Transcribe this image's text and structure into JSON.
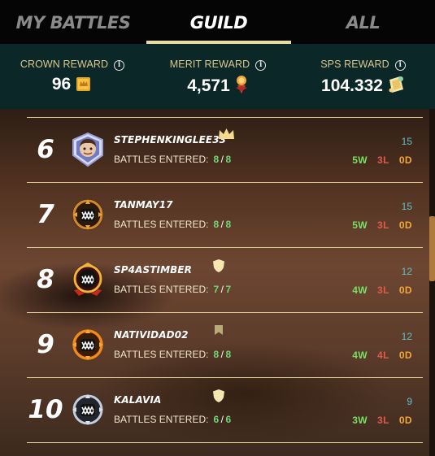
{
  "tabs": {
    "my_battles": "MY BATTLES",
    "guild": "GUILD",
    "all": "ALL"
  },
  "rewards": [
    {
      "label": "CROWN REWARD",
      "value": "96",
      "icon": "crown-reward-icon"
    },
    {
      "label": "MERIT REWARD",
      "value": "4,571",
      "icon": "merit-medal-icon"
    },
    {
      "label": "SPS REWARD",
      "value": "104.332",
      "icon": "sps-token-icon"
    }
  ],
  "entered_label": "BATTLES ENTERED:",
  "players": [
    {
      "rank": "6",
      "name": "STEPHENKINGLEE33",
      "badge": "crown-icon",
      "entered": "8",
      "total": "8",
      "rating": "15",
      "wins": "5W",
      "losses": "3L",
      "draws": "0D",
      "avatar": "portrait-avatar"
    },
    {
      "rank": "7",
      "name": "TANMAY17",
      "badge": "",
      "entered": "8",
      "total": "8",
      "rating": "15",
      "wins": "5W",
      "losses": "3L",
      "draws": "0D",
      "avatar": "gold-monster-avatar"
    },
    {
      "rank": "8",
      "name": "SP4ASTIMBER",
      "badge": "shield-icon",
      "entered": "7",
      "total": "7",
      "rating": "12",
      "wins": "4W",
      "losses": "3L",
      "draws": "0D",
      "avatar": "red-gold-monster-avatar"
    },
    {
      "rank": "9",
      "name": "NATIVIDAD02",
      "badge": "banner-icon",
      "entered": "8",
      "total": "8",
      "rating": "12",
      "wins": "4W",
      "losses": "4L",
      "draws": "0D",
      "avatar": "orange-monster-avatar"
    },
    {
      "rank": "10",
      "name": "KALAVIA",
      "badge": "shield-icon",
      "entered": "6",
      "total": "6",
      "rating": "9",
      "wins": "3W",
      "losses": "3L",
      "draws": "0D",
      "avatar": "silver-monster-avatar"
    }
  ],
  "colors": {
    "accent_gold": "#e9dca0",
    "reward_bar": "#0c2727",
    "win": "#79df66",
    "loss": "#e25a4c",
    "draw": "#f2a837",
    "rating": "#5fc0c9"
  }
}
